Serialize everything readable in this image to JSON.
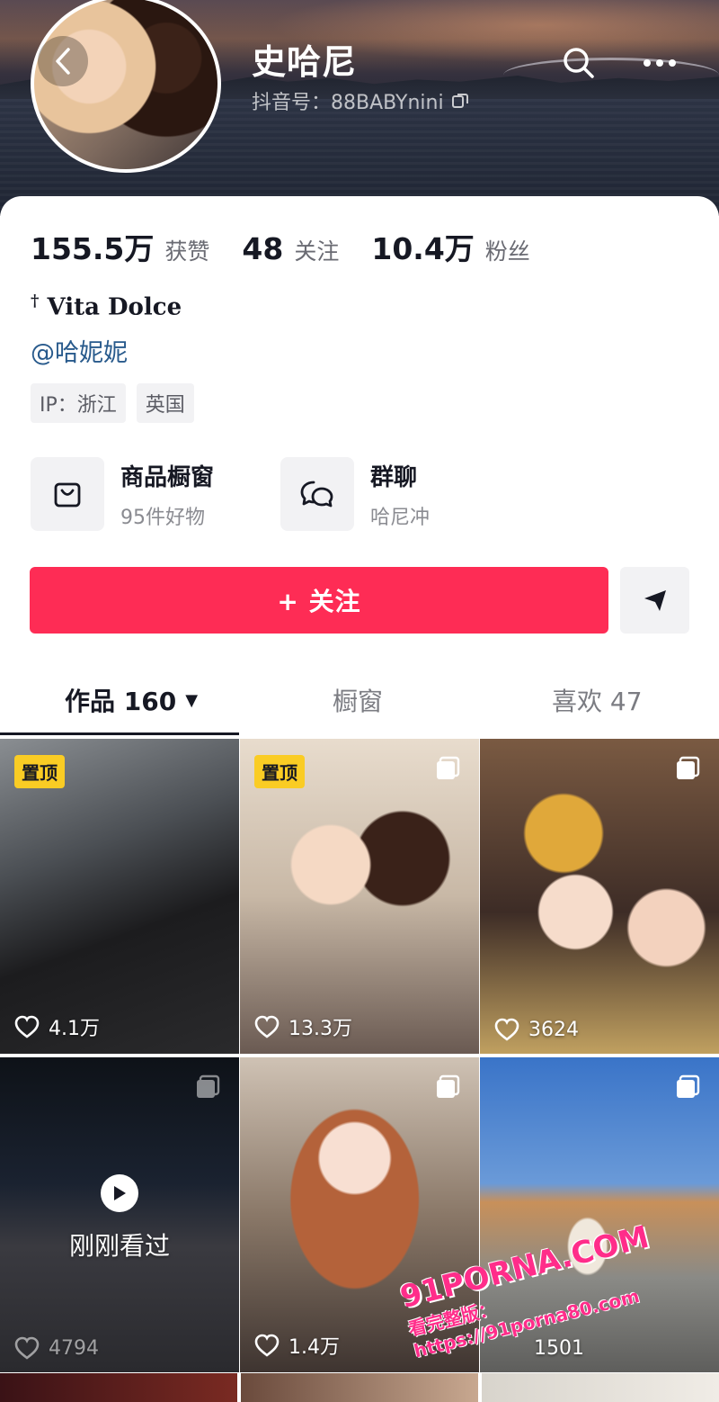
{
  "profile": {
    "nickname": "史哈尼",
    "douyin_id": "抖音号：88BABYnini",
    "stats": [
      {
        "value": "155.5万",
        "label": "获赞"
      },
      {
        "value": "48",
        "label": "关注"
      },
      {
        "value": "10.4万",
        "label": "粉丝"
      }
    ],
    "bio": "Vita Dolce",
    "bio_prefix": "†",
    "mention": "@哈妮妮",
    "tags": [
      "IP：浙江",
      "英国"
    ]
  },
  "features": {
    "shop": {
      "title": "商品橱窗",
      "subtitle": "95件好物"
    },
    "group_chat": {
      "title": "群聊",
      "subtitle": "哈尼冲"
    }
  },
  "actions": {
    "follow_label": "+ 关注"
  },
  "tabs": {
    "works": {
      "label": "作品 160",
      "arrow": "▼"
    },
    "showcase": {
      "label": "橱窗"
    },
    "likes": {
      "label": "喜欢 47"
    }
  },
  "videos": [
    {
      "pinned_label": "置顶",
      "likes": "4.1万"
    },
    {
      "pinned_label": "置顶",
      "likes": "13.3万"
    },
    {
      "likes": "3624"
    },
    {
      "recent_label": "刚刚看过",
      "likes": "4794"
    },
    {
      "likes": "1.4万"
    },
    {
      "likes": "1501"
    }
  ],
  "watermark": {
    "brand": "91PORNA.COM",
    "url": "https://91porna80.com",
    "prefix": "看完整版："
  },
  "colors": {
    "accent": "#fe2c55",
    "pin_badge": "#facc24",
    "mention_link": "#285a8c",
    "watermark": "#ff2d8a"
  },
  "icons": [
    "back-icon",
    "search-icon",
    "more-icon",
    "copy-icon",
    "shopping-bag-icon",
    "chat-bubbles-icon",
    "send-icon",
    "heart-icon",
    "multi-image-icon",
    "play-icon"
  ]
}
